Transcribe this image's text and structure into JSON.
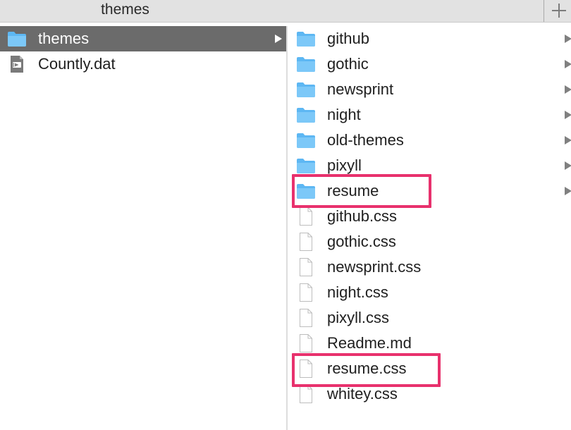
{
  "window": {
    "title": "themes",
    "add_icon": "plus-icon"
  },
  "left_column": {
    "items": [
      {
        "label": "themes",
        "icon": "folder-icon",
        "selected": true,
        "has_children": true
      },
      {
        "label": "Countly.dat",
        "icon": "video-file-icon",
        "selected": false,
        "has_children": false
      }
    ]
  },
  "right_column": {
    "items": [
      {
        "label": "github",
        "icon": "folder-icon",
        "has_children": true
      },
      {
        "label": "gothic",
        "icon": "folder-icon",
        "has_children": true
      },
      {
        "label": "newsprint",
        "icon": "folder-icon",
        "has_children": true
      },
      {
        "label": "night",
        "icon": "folder-icon",
        "has_children": true
      },
      {
        "label": "old-themes",
        "icon": "folder-icon",
        "has_children": true
      },
      {
        "label": "pixyll",
        "icon": "folder-icon",
        "has_children": true
      },
      {
        "label": "resume",
        "icon": "folder-icon",
        "has_children": true,
        "highlighted": true
      },
      {
        "label": "github.css",
        "icon": "document-icon",
        "has_children": false
      },
      {
        "label": "gothic.css",
        "icon": "document-icon",
        "has_children": false
      },
      {
        "label": "newsprint.css",
        "icon": "document-icon",
        "has_children": false
      },
      {
        "label": "night.css",
        "icon": "document-icon",
        "has_children": false
      },
      {
        "label": "pixyll.css",
        "icon": "document-icon",
        "has_children": false
      },
      {
        "label": "Readme.md",
        "icon": "document-icon",
        "has_children": false
      },
      {
        "label": "resume.css",
        "icon": "document-icon",
        "has_children": false,
        "highlighted": true
      },
      {
        "label": "whitey.css",
        "icon": "document-icon",
        "has_children": false
      }
    ]
  },
  "colors": {
    "selection": "#6b6b6b",
    "highlight": "#e8316d",
    "folder": "#5db7f3"
  }
}
